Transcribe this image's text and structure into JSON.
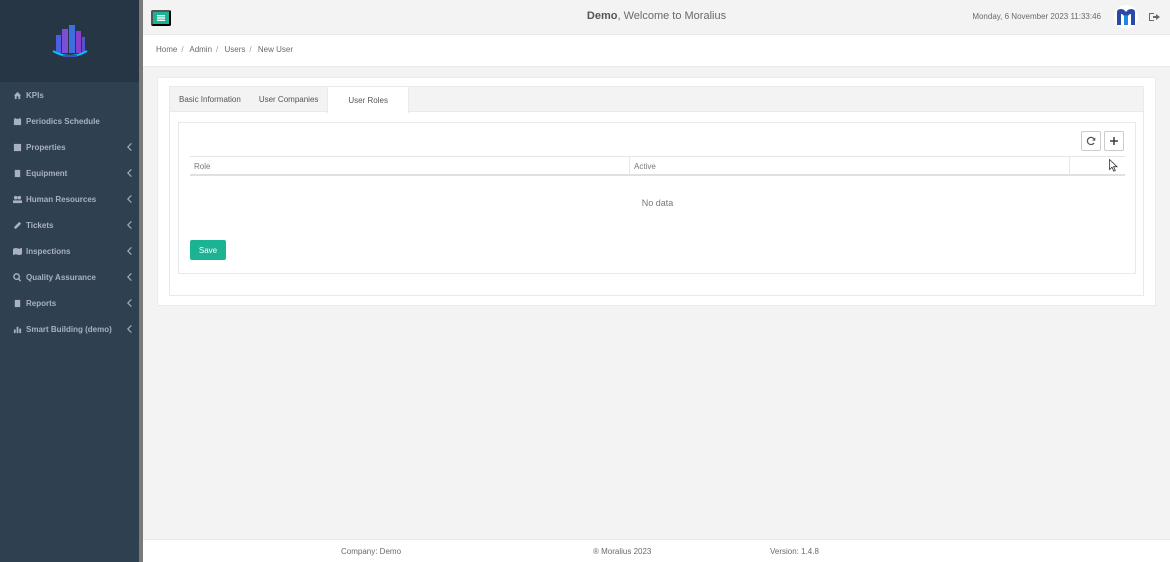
{
  "header": {
    "user": "Demo",
    "welcome_suffix": ", Welcome to Moralius",
    "datetime": "Monday, 6 November 2023 11:33:46"
  },
  "sidebar": {
    "items": [
      {
        "label": "KPIs",
        "icon": "dashboard-icon",
        "has_submenu": false
      },
      {
        "label": "Periodics Schedule",
        "icon": "calendar-icon",
        "has_submenu": false
      },
      {
        "label": "Properties",
        "icon": "building-icon",
        "has_submenu": true
      },
      {
        "label": "Equipment",
        "icon": "book-icon",
        "has_submenu": true
      },
      {
        "label": "Human Resources",
        "icon": "users-icon",
        "has_submenu": true
      },
      {
        "label": "Tickets",
        "icon": "ticket-icon",
        "has_submenu": true
      },
      {
        "label": "Inspections",
        "icon": "map-icon",
        "has_submenu": true
      },
      {
        "label": "Quality Assurance",
        "icon": "search-icon",
        "has_submenu": true
      },
      {
        "label": "Reports",
        "icon": "report-icon",
        "has_submenu": true
      },
      {
        "label": "Smart Building (demo)",
        "icon": "bar-chart-icon",
        "has_submenu": true
      }
    ]
  },
  "breadcrumb": [
    "Home",
    "Admin",
    "Users",
    "New User"
  ],
  "tabs": [
    {
      "label": "Basic Information",
      "active": false
    },
    {
      "label": "User Companies",
      "active": false
    },
    {
      "label": "User Roles",
      "active": true
    }
  ],
  "grid": {
    "columns": [
      "Role",
      "Active",
      ""
    ],
    "empty_text": "No data"
  },
  "save_label": "Save",
  "footer": {
    "company": "Company: Demo",
    "copyright": "® Moralius 2023",
    "version": "Version: 1.4.8"
  },
  "colors": {
    "accent": "#1ab394",
    "sidebar": "#2f4050"
  }
}
